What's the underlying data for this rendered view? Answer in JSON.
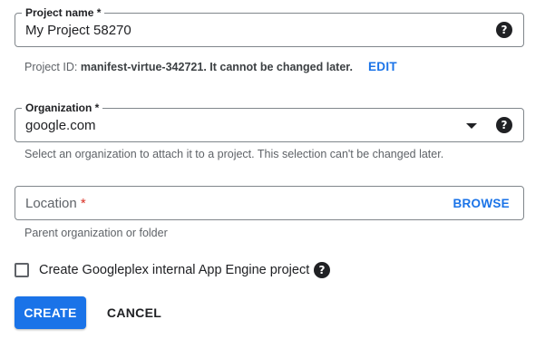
{
  "project_name": {
    "label": "Project name *",
    "value": "My Project 58270"
  },
  "project_id": {
    "prefix": "Project ID: ",
    "id": "manifest-virtue-342721",
    "suffix_bold": ". It cannot be changed later.",
    "edit_label": "EDIT"
  },
  "organization": {
    "label": "Organization *",
    "value": "google.com",
    "hint": "Select an organization to attach it to a project. This selection can't be changed later."
  },
  "location": {
    "placeholder": "Location",
    "required_mark": "*",
    "browse_label": "BROWSE",
    "hint": "Parent organization or folder"
  },
  "appengine": {
    "checked": false,
    "label": "Create Googleplex internal App Engine project"
  },
  "help_glyph": "?",
  "actions": {
    "create_label": "CREATE",
    "cancel_label": "CANCEL"
  },
  "colors": {
    "primary": "#1a73e8",
    "required": "#d93025",
    "border": "#80868b"
  }
}
